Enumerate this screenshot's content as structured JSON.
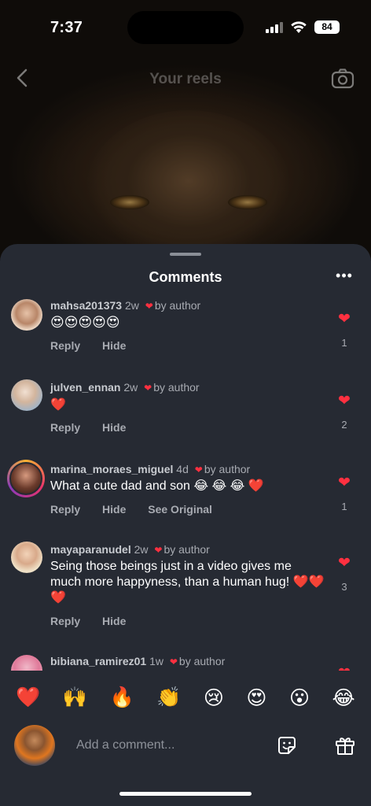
{
  "status": {
    "time": "7:37",
    "battery": "84"
  },
  "header": {
    "title": "Your reels"
  },
  "sheet": {
    "title": "Comments"
  },
  "comments": [
    {
      "user": "mahsa201373",
      "age": "2w",
      "liked_by": "by author",
      "text": "😍😍😍😍😍",
      "actions": [
        "Reply",
        "Hide"
      ],
      "likes": "1"
    },
    {
      "user": "julven_ennan",
      "age": "2w",
      "liked_by": "by author",
      "text": "❤️",
      "actions": [
        "Reply",
        "Hide"
      ],
      "likes": "2"
    },
    {
      "user": "marina_moraes_miguel",
      "age": "4d",
      "liked_by": "by author",
      "text": "What a cute dad and son 😂 😂 😂 ❤️",
      "actions": [
        "Reply",
        "Hide",
        "See Original"
      ],
      "likes": "1"
    },
    {
      "user": "mayaparanudel",
      "age": "2w",
      "liked_by": "by author",
      "text": "Seing those beings just in a video gives me much more happyness, than a human hug! ❤️❤️❤️",
      "actions": [
        "Reply",
        "Hide"
      ],
      "likes": "3"
    },
    {
      "user": "bibiana_ramirez01",
      "age": "1w",
      "liked_by": "by author"
    }
  ],
  "quick_reactions": [
    "❤️",
    "🙌",
    "🔥",
    "👏",
    "😢",
    "😍",
    "😮",
    "😂"
  ],
  "input": {
    "placeholder": "Add a comment..."
  },
  "icons": {
    "back": "chevron-left-icon",
    "camera": "camera-icon",
    "more": "more-horizontal-icon",
    "like": "heart-icon",
    "sticker": "sticker-icon",
    "gift": "gift-icon"
  },
  "colors": {
    "accent_heart": "#ff3040",
    "sheet_bg": "#262a33"
  }
}
